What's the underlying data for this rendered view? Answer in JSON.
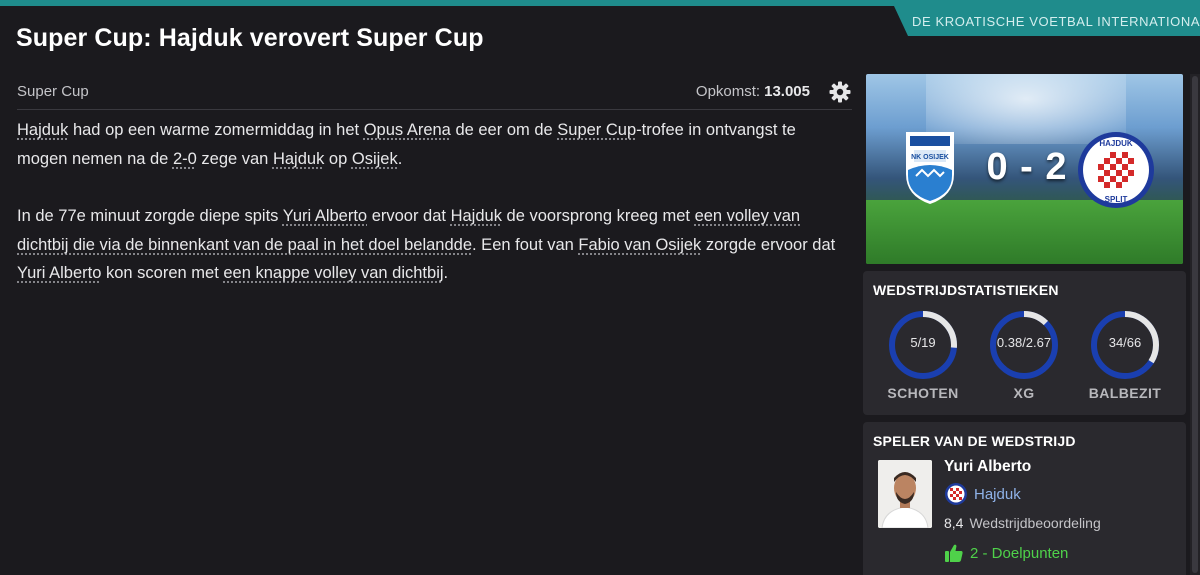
{
  "source": {
    "label": "DE KROATISCHE VOETBAL INTERNATIONAL"
  },
  "headline": "Super Cup: Hajduk verovert Super Cup",
  "meta": {
    "competition": "Super Cup",
    "attendance_label": "Opkomst:",
    "attendance_value": "13.005"
  },
  "article": {
    "p1": [
      {
        "text": "Hajduk",
        "link": true
      },
      {
        "text": " had op een warme zomermiddag in het ",
        "link": false
      },
      {
        "text": "Opus Arena",
        "link": true
      },
      {
        "text": " de eer om de ",
        "link": false
      },
      {
        "text": "Super Cup",
        "link": true
      },
      {
        "text": "-trofee in ontvangst te mogen nemen na de ",
        "link": false
      },
      {
        "text": "2-0",
        "link": true
      },
      {
        "text": " zege van ",
        "link": false
      },
      {
        "text": "Hajduk",
        "link": true
      },
      {
        "text": " op ",
        "link": false
      },
      {
        "text": "Osijek",
        "link": true
      },
      {
        "text": ".",
        "link": false
      }
    ],
    "p2": [
      {
        "text": "In de 77e minuut zorgde diepe spits ",
        "link": false
      },
      {
        "text": "Yuri Alberto",
        "link": true
      },
      {
        "text": " ervoor dat ",
        "link": false
      },
      {
        "text": "Hajduk",
        "link": true
      },
      {
        "text": " de voorsprong kreeg met ",
        "link": false
      },
      {
        "text": "een volley van dichtbij die via de binnenkant van de paal in het doel belandde",
        "link": true
      },
      {
        "text": ". Een fout van ",
        "link": false
      },
      {
        "text": "Fabio van Osijek",
        "link": true
      },
      {
        "text": " zorgde ervoor dat ",
        "link": false
      },
      {
        "text": "Yuri Alberto",
        "link": true
      },
      {
        "text": " kon scoren met ",
        "link": false
      },
      {
        "text": "een knappe volley van dichtbij",
        "link": true
      },
      {
        "text": ".",
        "link": false
      }
    ]
  },
  "match": {
    "home_team": "NK OSIJEK",
    "away_team": "HAJDUK SPLIT",
    "score": "0 - 2"
  },
  "stats": {
    "title": "WEDSTRIJDSTATISTIEKEN",
    "items": [
      {
        "value": "5/19",
        "label": "SCHOTEN",
        "home_fraction": 0.2632
      },
      {
        "value": "0.38/2.67",
        "label": "XG",
        "home_fraction": 0.1246
      },
      {
        "value": "34/66",
        "label": "BALBEZIT",
        "home_fraction": 0.34
      }
    ],
    "colors": {
      "home": "#e6e6e6",
      "away": "#1a3fb0"
    }
  },
  "potm": {
    "title": "SPELER VAN DE WEDSTRIJD",
    "player": "Yuri Alberto",
    "club": "Hajduk",
    "rating_value": "8,4",
    "rating_label": "Wedstrijdbeoordeling",
    "goals": "2 - Doelpunten"
  },
  "icons": {
    "settings": "gear-icon",
    "home_crest": "osijek-crest-icon",
    "away_crest": "hajduk-crest-icon",
    "goals": "thumbs-up-icon"
  }
}
